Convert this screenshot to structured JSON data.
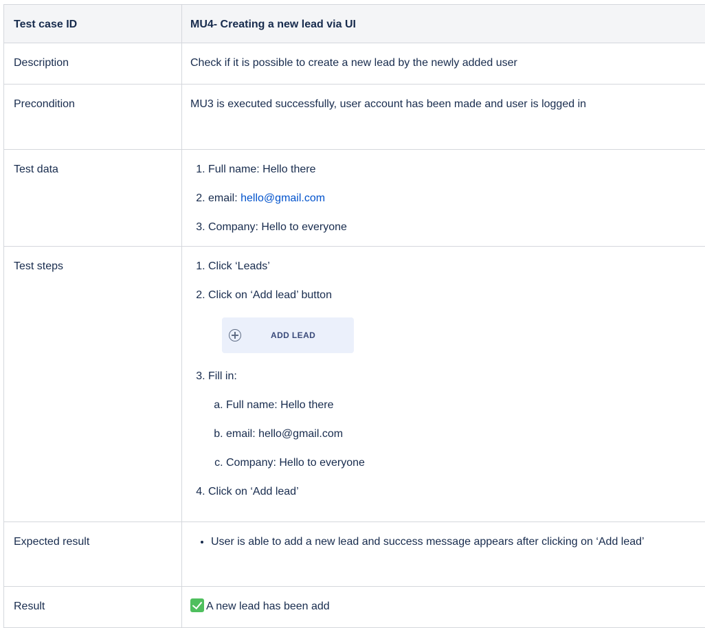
{
  "rows": {
    "header": {
      "label": "Test case ID",
      "value": "MU4- Creating a new lead via UI"
    },
    "description": {
      "label": "Description",
      "value": "Check if it is possible to create a new lead by the newly added user"
    },
    "precondition": {
      "label": "Precondition",
      "value": "MU3 is executed successfully, user account has been made and user is logged in"
    },
    "test_data": {
      "label": "Test data",
      "items": [
        {
          "prefix": "Full name: ",
          "value": "Hello there"
        },
        {
          "prefix": "email: ",
          "value": "hello@gmail.com"
        },
        {
          "prefix": "Company: ",
          "value": "Hello to everyone"
        }
      ]
    },
    "test_steps": {
      "label": "Test steps",
      "step1": "Click ‘Leads’",
      "step2": "Click on ‘Add lead’ button",
      "button_image_label": "ADD LEAD",
      "button_image_icon": "plus-circle-icon",
      "step3": "Fill in:",
      "step3_sub": [
        "Full name: Hello there",
        "email: hello@gmail.com",
        "Company: Hello to everyone"
      ],
      "step4": "Click on ‘Add lead’"
    },
    "expected_result": {
      "label": "Expected result",
      "items": [
        "User is able to add a new lead and success message appears after clicking on ‘Add lead’"
      ]
    },
    "result": {
      "label": "Result",
      "icon": "check-mark-icon",
      "value": "A new lead has been add"
    }
  },
  "colors": {
    "header_bg": "#f4f5f7",
    "border": "#d4d7dc",
    "link": "#0052cc",
    "check": "#4fbf5e"
  }
}
